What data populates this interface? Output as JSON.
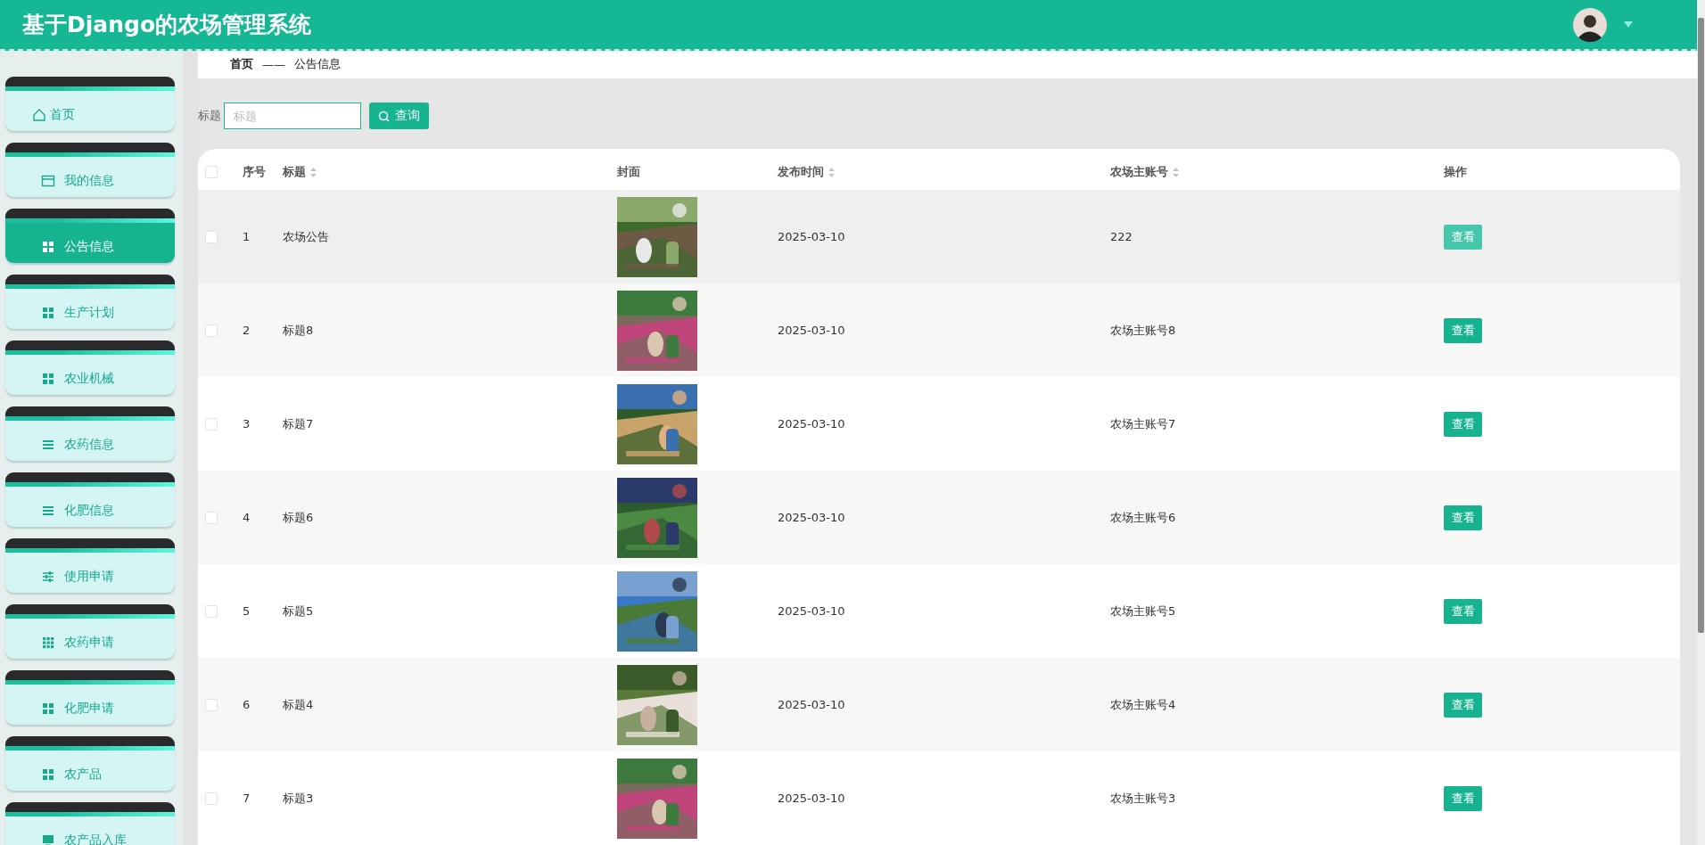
{
  "header": {
    "title": "基于Django的农场管理系统"
  },
  "sidebar": {
    "items": [
      {
        "label": "首页",
        "selected": false
      },
      {
        "label": "我的信息",
        "selected": false
      },
      {
        "label": "公告信息",
        "selected": true
      },
      {
        "label": "生产计划",
        "selected": false
      },
      {
        "label": "农业机械",
        "selected": false
      },
      {
        "label": "农药信息",
        "selected": false
      },
      {
        "label": "化肥信息",
        "selected": false
      },
      {
        "label": "使用申请",
        "selected": false
      },
      {
        "label": "农药申请",
        "selected": false
      },
      {
        "label": "化肥申请",
        "selected": false
      },
      {
        "label": "农产品",
        "selected": false
      },
      {
        "label": "农产品入库",
        "selected": false
      }
    ]
  },
  "breadcrumb": {
    "items": [
      "首页",
      "公告信息"
    ],
    "separator": "——"
  },
  "search": {
    "label": "标题",
    "placeholder": "标题",
    "button": "查询"
  },
  "table": {
    "select_all_checked": false,
    "columns": [
      {
        "label": "序号",
        "sortable": false
      },
      {
        "label": "标题",
        "sortable": true
      },
      {
        "label": "封面",
        "sortable": false
      },
      {
        "label": "发布时间",
        "sortable": true
      },
      {
        "label": "农场主账号",
        "sortable": true
      },
      {
        "label": "操作",
        "sortable": false
      }
    ],
    "rows": [
      {
        "index": "1",
        "title": "农场公告",
        "date": "2025-03-10",
        "account": "222",
        "action": "查看",
        "checked": false,
        "highlighted": true
      },
      {
        "index": "2",
        "title": "标题8",
        "date": "2025-03-10",
        "account": "农场主账号8",
        "action": "查看",
        "checked": false,
        "highlighted": false
      },
      {
        "index": "3",
        "title": "标题7",
        "date": "2025-03-10",
        "account": "农场主账号7",
        "action": "查看",
        "checked": false,
        "highlighted": false
      },
      {
        "index": "4",
        "title": "标题6",
        "date": "2025-03-10",
        "account": "农场主账号6",
        "action": "查看",
        "checked": false,
        "highlighted": false
      },
      {
        "index": "5",
        "title": "标题5",
        "date": "2025-03-10",
        "account": "农场主账号5",
        "action": "查看",
        "checked": false,
        "highlighted": false
      },
      {
        "index": "6",
        "title": "标题4",
        "date": "2025-03-10",
        "account": "农场主账号4",
        "action": "查看",
        "checked": false,
        "highlighted": false
      },
      {
        "index": "7",
        "title": "标题3",
        "date": "2025-03-10",
        "account": "农场主账号3",
        "action": "查看",
        "checked": false,
        "highlighted": false
      }
    ]
  }
}
